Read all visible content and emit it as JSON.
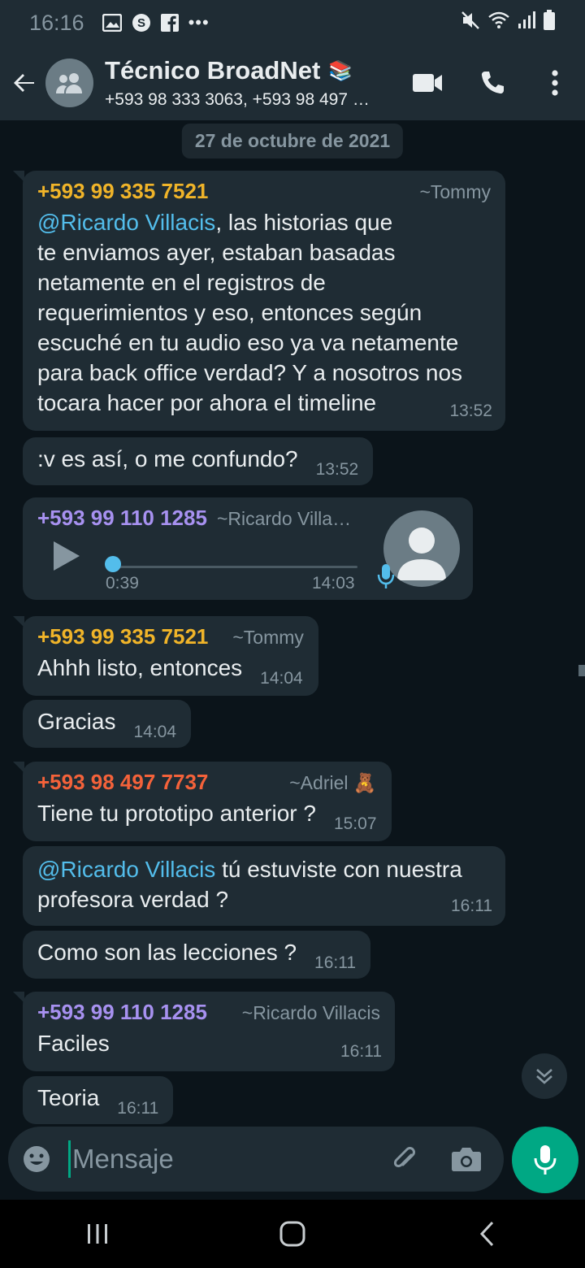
{
  "status_bar": {
    "time": "16:16",
    "overflow": "•••",
    "icons_left": [
      "image-icon",
      "skype-icon",
      "facebook-icon"
    ],
    "icons_right": [
      "mute-icon",
      "wifi-icon",
      "signal-icon",
      "battery-icon"
    ]
  },
  "header": {
    "title": "Técnico BroadNet",
    "title_emoji": "📚",
    "subtitle": "+593 98 333 3063, +593 98 497 …"
  },
  "chat": {
    "date_chip": "27 de octubre de 2021",
    "messages": [
      {
        "sender": "+593 99 335 7521",
        "alias": "~Tommy",
        "mention": "@Ricardo Villacis",
        "text_l1": ", las historias que",
        "text_l2": "te enviamos ayer, estaban basadas",
        "text_l3": "netamente en el registros de",
        "text_l4": "requerimientos y eso, entonces según",
        "text_l5": "escuché en tu audio eso ya va netamente",
        "text_l6": "para back office verdad? Y a nosotros nos",
        "text_l7": "tocara hacer por ahora el timeline",
        "time": "13:52"
      },
      {
        "text": ":v es así, o me confundo?",
        "time": "13:52"
      },
      {
        "type": "voice",
        "sender": "+593 99 110 1285",
        "alias": "~Ricardo Villa…",
        "duration": "0:39",
        "time": "14:03",
        "progress": 0
      },
      {
        "sender": "+593 99 335 7521",
        "alias": "~Tommy",
        "text": "Ahhh listo, entonces",
        "time": "14:04"
      },
      {
        "text": "Gracias",
        "time": "14:04"
      },
      {
        "sender": "+593 98 497 7737",
        "alias": "~Adriel 🧸",
        "text": "Tiene tu prototipo anterior ?",
        "time": "15:07"
      },
      {
        "mention": "@Ricardo Villacis",
        "text_l1": " tú estuviste con nuestra",
        "text_l2": "profesora verdad ?",
        "time": "16:11"
      },
      {
        "text": "Como son las lecciones ?",
        "time": "16:11"
      },
      {
        "sender": "+593 99 110 1285",
        "alias": "~Ricardo Villacis",
        "text": "Faciles",
        "time": "16:11"
      },
      {
        "text": "Teoria",
        "time": "16:11"
      }
    ]
  },
  "input": {
    "placeholder": "Mensaje"
  },
  "colors": {
    "background": "#0b141a",
    "bubble": "#1f2c34",
    "sender_tommy": "#f0b429",
    "sender_ricardo": "#a791f0",
    "sender_adriel": "#f4623a",
    "mention": "#53bdeb",
    "accent": "#00a884"
  }
}
